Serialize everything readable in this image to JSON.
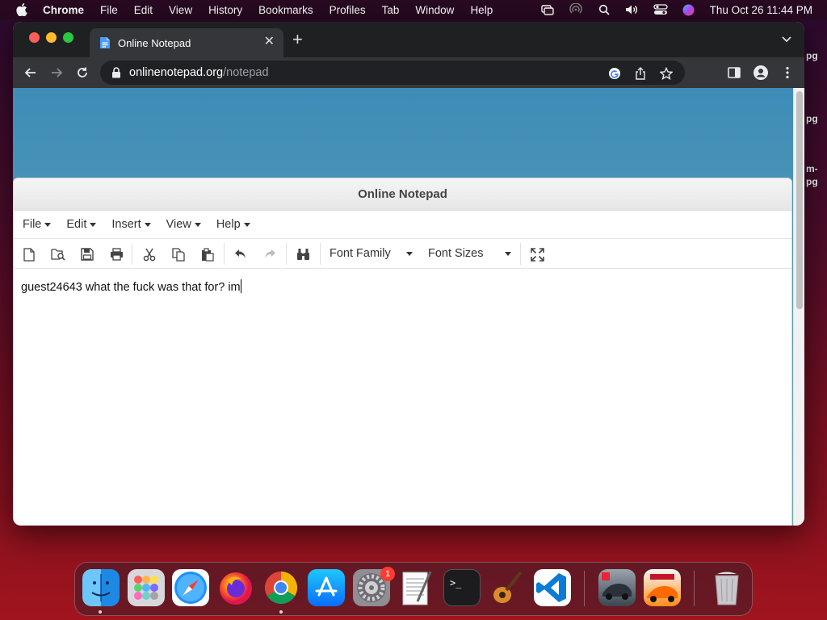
{
  "menubar": {
    "app": "Chrome",
    "items": [
      "File",
      "Edit",
      "View",
      "History",
      "Bookmarks",
      "Profiles",
      "Tab",
      "Window",
      "Help"
    ],
    "clock": "Thu Oct 26  11:44 PM"
  },
  "desktop_labels": [
    "pg",
    "pg",
    "m-",
    "pg"
  ],
  "browser": {
    "tab_title": "Online Notepad",
    "url_host": "onlinenotepad.org",
    "url_path": "/notepad"
  },
  "notepad": {
    "title": "Online Notepad",
    "menu": [
      "File",
      "Edit",
      "Insert",
      "View",
      "Help"
    ],
    "font_family_label": "Font Family",
    "font_sizes_label": "Font Sizes",
    "content": "guest24643 what the fuck was that for? im"
  },
  "dock": {
    "apps": [
      "Finder",
      "Launchpad",
      "Safari",
      "Firefox",
      "Chrome",
      "App Store",
      "System Settings",
      "TextEdit",
      "Terminal",
      "GarageBand",
      "Visual Studio Code",
      "Asphalt 8",
      "Asphalt 9",
      "Trash"
    ],
    "settings_badge": "1"
  },
  "colors": {
    "chrome_dark": "#35363a",
    "accent_blue": "#1a73e8"
  }
}
